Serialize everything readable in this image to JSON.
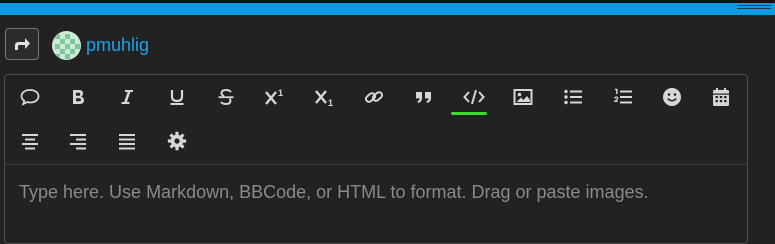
{
  "header": {
    "username": "pmuhlig"
  },
  "toolbar": {
    "superscript_mark": "1",
    "subscript_mark": "1",
    "active_color": "#3ddc2f",
    "buttons": [
      {
        "name": "quote-bubble",
        "icon": "speech-bubble-icon"
      },
      {
        "name": "bold",
        "icon": "bold-icon"
      },
      {
        "name": "italic",
        "icon": "italic-icon"
      },
      {
        "name": "underline",
        "icon": "underline-icon"
      },
      {
        "name": "strikethrough",
        "icon": "strikethrough-icon"
      },
      {
        "name": "superscript",
        "icon": "superscript-icon"
      },
      {
        "name": "subscript",
        "icon": "subscript-icon"
      },
      {
        "name": "link",
        "icon": "link-icon"
      },
      {
        "name": "blockquote",
        "icon": "quote-icon"
      },
      {
        "name": "code",
        "icon": "code-icon",
        "active": true
      },
      {
        "name": "image",
        "icon": "image-icon"
      },
      {
        "name": "bullet-list",
        "icon": "bullet-list-icon"
      },
      {
        "name": "numbered-list",
        "icon": "numbered-list-icon"
      },
      {
        "name": "emoji",
        "icon": "smiley-icon"
      },
      {
        "name": "date",
        "icon": "calendar-icon"
      },
      {
        "name": "align-center",
        "icon": "align-center-icon"
      },
      {
        "name": "align-right",
        "icon": "align-right-icon"
      },
      {
        "name": "justify",
        "icon": "justify-icon"
      },
      {
        "name": "settings",
        "icon": "gear-icon"
      }
    ]
  },
  "editor": {
    "placeholder": "Type here. Use Markdown, BBCode, or HTML to format. Drag or paste images."
  },
  "colors": {
    "background": "#222222",
    "topbar": "#0a9be0",
    "username": "#1aa3e8"
  }
}
